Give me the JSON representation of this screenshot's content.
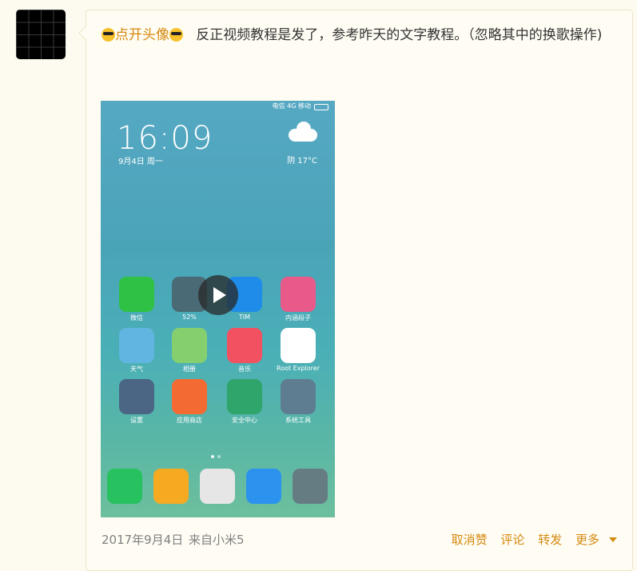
{
  "post": {
    "link_text": "点开头像",
    "text": "反正视频教程是发了，参考昨天的文字教程。（忽略其中的换歌操作)"
  },
  "video": {
    "status_right": "电信 4G  移动",
    "time": "16:09",
    "date": "9月4日 周一",
    "weather": "阴  17°C",
    "apps": [
      {
        "label": "微信",
        "color": "#2fc145"
      },
      {
        "label": "52%",
        "color": "#4a6a76"
      },
      {
        "label": "TIM",
        "color": "#1e8ce8"
      },
      {
        "label": "内涵段子",
        "color": "#e85a8a"
      },
      {
        "label": "天气",
        "color": "#60b6e0"
      },
      {
        "label": "相册",
        "color": "#85cf6e"
      },
      {
        "label": "音乐",
        "color": "#f25162"
      },
      {
        "label": "Root Explorer",
        "color": "#ffffff"
      },
      {
        "label": "设置",
        "color": "#4b6585"
      },
      {
        "label": "应用商店",
        "color": "#f36a32"
      },
      {
        "label": "安全中心",
        "color": "#2fa46b"
      },
      {
        "label": "系统工具",
        "color": "#5f7d91"
      }
    ],
    "dock_colors": [
      "#28c160",
      "#f6aa22",
      "#e6e6e6",
      "#2b92ee",
      "#667c83"
    ]
  },
  "footer": {
    "date": "2017年9月4日",
    "source": "来自小米5",
    "actions": [
      "取消赞",
      "评论",
      "转发",
      "更多"
    ]
  },
  "colors": {
    "accent": "#d58810",
    "background": "#fdfbef"
  }
}
